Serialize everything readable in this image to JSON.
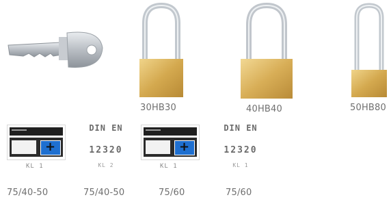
{
  "products": [
    {
      "caption": "30HB30"
    },
    {
      "caption": "40HB40"
    },
    {
      "caption": "50HB80"
    }
  ],
  "badges": [
    {
      "type": "cert",
      "label": "KL 1",
      "caption": "75/40-50"
    },
    {
      "type": "din",
      "title": "DIN EN",
      "number": "12320",
      "sub": "KL 2",
      "caption": "75/40-50"
    },
    {
      "type": "cert",
      "label": "KL 1",
      "caption": "75/60"
    },
    {
      "type": "din",
      "title": "DIN EN",
      "number": "12320",
      "sub": "KL 1",
      "caption": "75/60"
    }
  ],
  "colors": {
    "brass": "#d9b25a",
    "shackle": "#c9ced3",
    "badge_blue": "#1e6fd0"
  }
}
